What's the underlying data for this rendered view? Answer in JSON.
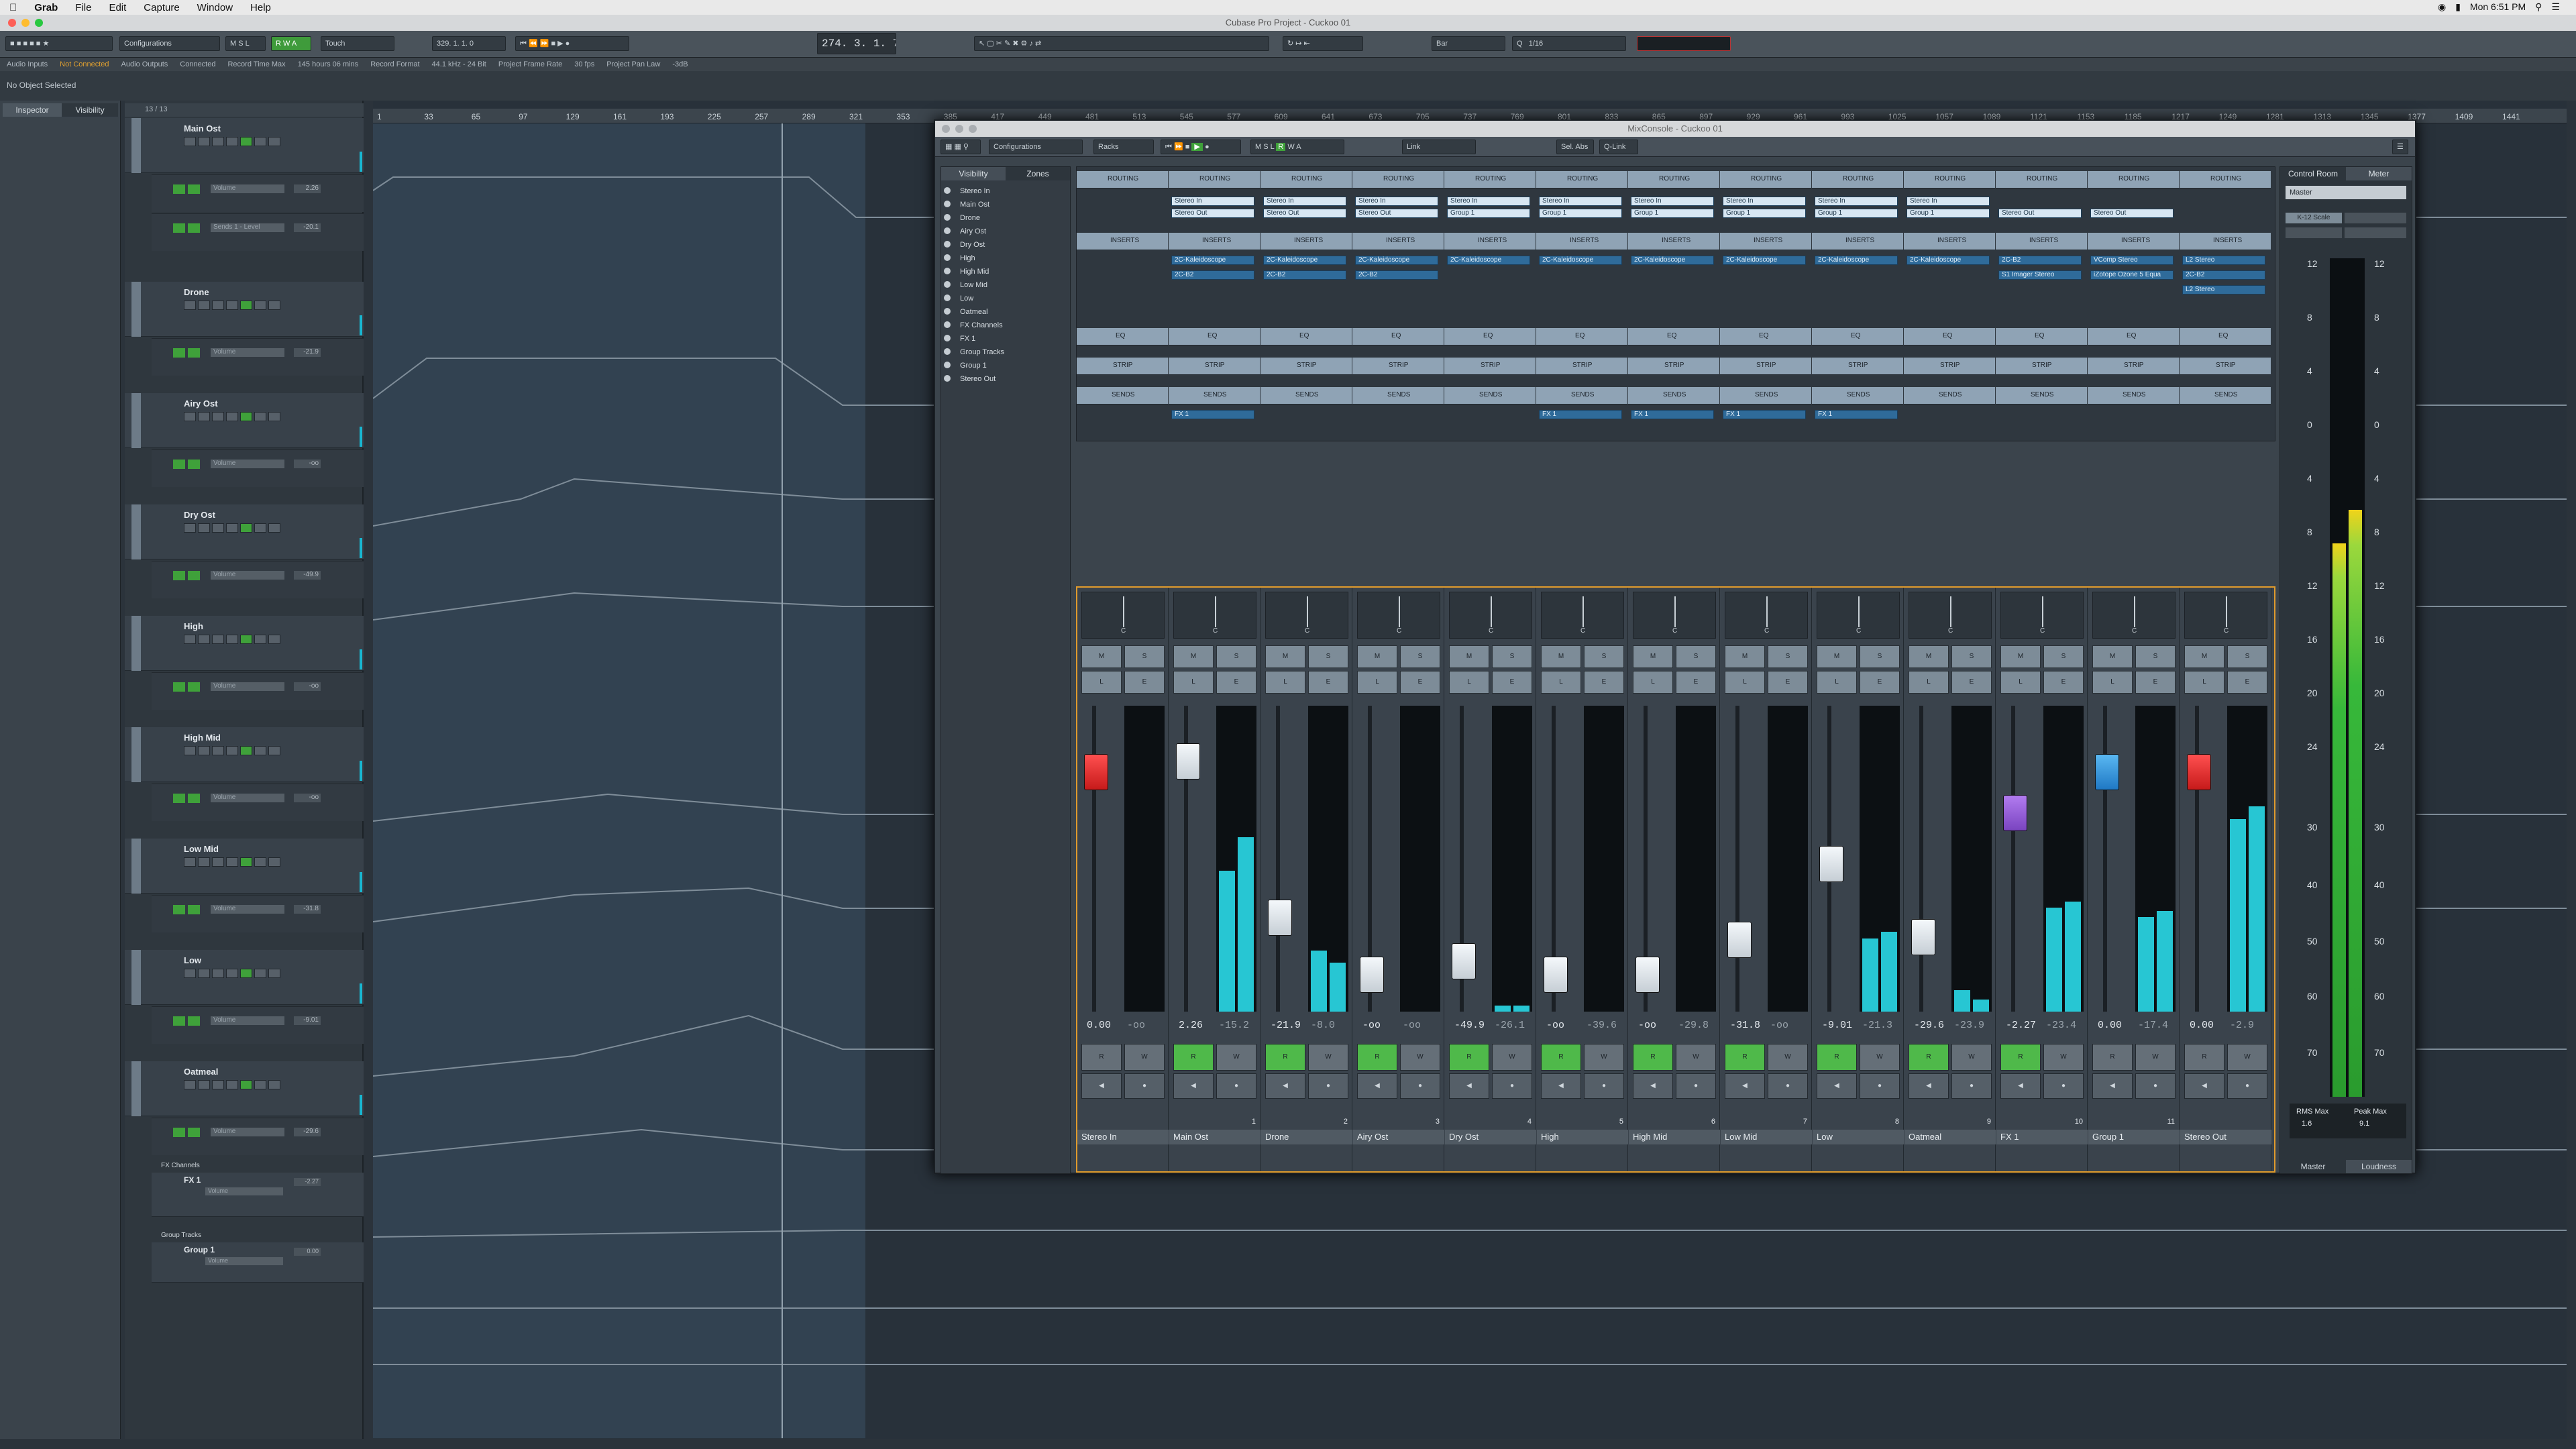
{
  "menubar": {
    "app": "Grab",
    "items": [
      "File",
      "Edit",
      "Capture",
      "Window",
      "Help"
    ],
    "time": "Mon 6:51 PM"
  },
  "window": {
    "title": "Cubase Pro Project - Cuckoo 01"
  },
  "toolbar": {
    "configurations": "Configurations",
    "touch": "Touch",
    "counter": "274. 3. 1. 79",
    "counter_small": "329. 1. 1. 0",
    "snap": "1/16",
    "bar": "Bar",
    "quantize": "Q"
  },
  "statusbar": {
    "audio_inputs": "Audio Inputs",
    "not_connected": "Not Connected",
    "audio_outputs": "Audio Outputs",
    "connected": "Connected",
    "record_time_label": "Record Time Max",
    "record_time": "145 hours 06 mins",
    "record_format_label": "Record Format",
    "record_format": "44.1 kHz - 24 Bit",
    "frame_rate_label": "Project Frame Rate",
    "frame_rate": "30 fps",
    "pan_law_label": "Project Pan Law",
    "pan_law": "-3dB"
  },
  "infoline": {
    "text": "No Object Selected"
  },
  "inspector": {
    "tabs": [
      "Inspector",
      "Visibility"
    ],
    "counter": "13 / 13"
  },
  "tracks": [
    {
      "name": "Main Ost",
      "lane": "Volume",
      "value": "2.26",
      "lane2": "Sends 1 - Level",
      "value2": "-20.1"
    },
    {
      "name": "Drone",
      "lane": "Volume",
      "value": "-21.9"
    },
    {
      "name": "Airy Ost",
      "lane": "Volume",
      "value": "-oo"
    },
    {
      "name": "Dry Ost",
      "lane": "Volume",
      "value": "-49.9"
    },
    {
      "name": "High",
      "lane": "Volume",
      "value": "-oo"
    },
    {
      "name": "High Mid",
      "lane": "Volume",
      "value": "-oo"
    },
    {
      "name": "Low Mid",
      "lane": "Volume",
      "value": "-31.8"
    },
    {
      "name": "Low",
      "lane": "Volume",
      "value": "-9.01"
    },
    {
      "name": "Oatmeal",
      "lane": "Volume",
      "value": "-29.6"
    }
  ],
  "folders": {
    "fx": "FX Channels",
    "fx1": "FX 1",
    "fx1_value": "-2.27",
    "group": "Group Tracks",
    "group1": "Group 1",
    "group1_value": "0.00",
    "lane": "Volume"
  },
  "ruler": [
    "1",
    "33",
    "65",
    "97",
    "129",
    "161",
    "193",
    "225",
    "257",
    "289",
    "321",
    "353",
    "385",
    "417",
    "449",
    "481",
    "513",
    "545",
    "577",
    "609",
    "641",
    "673",
    "705",
    "737",
    "769",
    "801",
    "833",
    "865",
    "897",
    "929",
    "961",
    "993",
    "1025",
    "1057",
    "1089",
    "1121",
    "1153",
    "1185",
    "1217",
    "1249",
    "1281",
    "1313",
    "1345",
    "1377",
    "1409",
    "1441"
  ],
  "mixer": {
    "title": "MixConsole - Cuckoo 01",
    "tool": {
      "configurations": "Configurations",
      "racks": "Racks",
      "link": "Link",
      "sel_abs": "Sel. Abs",
      "q_link": "Q-Link"
    },
    "visibility_tabs": [
      "Visibility",
      "Zones"
    ],
    "visibility_items": [
      "Stereo In",
      "Main Ost",
      "Drone",
      "Airy Ost",
      "Dry Ost",
      "High",
      "High Mid",
      "Low Mid",
      "Low",
      "Oatmeal",
      "FX Channels",
      "FX 1",
      "Group Tracks",
      "Group 1",
      "Stereo Out"
    ],
    "rack_labels": {
      "routing": "ROUTING",
      "inserts": "INSERTS",
      "eq": "EQ",
      "strip": "STRIP",
      "sends": "SENDS"
    },
    "channels": [
      {
        "name": "Stereo In",
        "num": "",
        "val": "0.00",
        "peak": "-oo",
        "in": "",
        "out": "",
        "ins": [],
        "send": "",
        "color": "r",
        "fader": 0.18,
        "m1": 0,
        "m2": 0,
        "rw": false
      },
      {
        "name": "Main Ost",
        "num": "1",
        "val": "2.26",
        "peak": "-15.2",
        "in": "Stereo In",
        "out": "Stereo Out",
        "ins": [
          "2C-Kaleidoscope",
          "2C-B2"
        ],
        "send": "FX 1",
        "color": "w",
        "fader": 0.14,
        "m1": 0.46,
        "m2": 0.57,
        "rw": true
      },
      {
        "name": "Drone",
        "num": "2",
        "val": "-21.9",
        "peak": "-8.0",
        "in": "Stereo In",
        "out": "Stereo Out",
        "ins": [
          "2C-Kaleidoscope",
          "2C-B2"
        ],
        "send": "",
        "color": "w",
        "fader": 0.72,
        "m1": 0.2,
        "m2": 0.16,
        "rw": true
      },
      {
        "name": "Airy Ost",
        "num": "3",
        "val": "-oo",
        "peak": "-oo",
        "in": "Stereo In",
        "out": "Stereo Out",
        "ins": [
          "2C-Kaleidoscope",
          "2C-B2"
        ],
        "send": "",
        "color": "w",
        "fader": 0.93,
        "m1": 0,
        "m2": 0,
        "rw": true
      },
      {
        "name": "Dry Ost",
        "num": "4",
        "val": "-49.9",
        "peak": "-26.1",
        "in": "Stereo In",
        "out": "Group 1",
        "ins": [
          "2C-Kaleidoscope"
        ],
        "send": "",
        "color": "w",
        "fader": 0.88,
        "m1": 0.02,
        "m2": 0.02,
        "rw": true
      },
      {
        "name": "High",
        "num": "5",
        "val": "-oo",
        "peak": "-39.6",
        "in": "Stereo In",
        "out": "Group 1",
        "ins": [
          "2C-Kaleidoscope"
        ],
        "send": "FX 1",
        "color": "w",
        "fader": 0.93,
        "m1": 0,
        "m2": 0,
        "rw": true
      },
      {
        "name": "High Mid",
        "num": "6",
        "val": "-oo",
        "peak": "-29.8",
        "in": "Stereo In",
        "out": "Group 1",
        "ins": [
          "2C-Kaleidoscope"
        ],
        "send": "FX 1",
        "color": "w",
        "fader": 0.93,
        "m1": 0,
        "m2": 0,
        "rw": true
      },
      {
        "name": "Low Mid",
        "num": "7",
        "val": "-31.8",
        "peak": "-oo",
        "in": "Stereo In",
        "out": "Group 1",
        "ins": [
          "2C-Kaleidoscope"
        ],
        "send": "FX 1",
        "color": "w",
        "fader": 0.8,
        "m1": 0,
        "m2": 0,
        "rw": true
      },
      {
        "name": "Low",
        "num": "8",
        "val": "-9.01",
        "peak": "-21.3",
        "in": "Stereo In",
        "out": "Group 1",
        "ins": [
          "2C-Kaleidoscope"
        ],
        "send": "FX 1",
        "color": "w",
        "fader": 0.52,
        "m1": 0.24,
        "m2": 0.26,
        "rw": true
      },
      {
        "name": "Oatmeal",
        "num": "9",
        "val": "-29.6",
        "peak": "-23.9",
        "in": "Stereo In",
        "out": "Group 1",
        "ins": [
          "2C-Kaleidoscope"
        ],
        "send": "",
        "color": "w",
        "fader": 0.79,
        "m1": 0.07,
        "m2": 0.04,
        "rw": true
      },
      {
        "name": "FX 1",
        "num": "10",
        "val": "-2.27",
        "peak": "-23.4",
        "in": "",
        "out": "Stereo Out",
        "ins": [
          "2C-B2",
          "S1 Imager Stereo"
        ],
        "send": "",
        "color": "p",
        "fader": 0.33,
        "m1": 0.34,
        "m2": 0.36,
        "rw": true
      },
      {
        "name": "Group 1",
        "num": "11",
        "val": "0.00",
        "peak": "-17.4",
        "in": "",
        "out": "Stereo Out",
        "ins": [
          "VComp Stereo",
          "iZotope Ozone 5 Equa"
        ],
        "send": "",
        "color": "b",
        "fader": 0.18,
        "m1": 0.31,
        "m2": 0.33,
        "rw": false
      },
      {
        "name": "Stereo Out",
        "num": "",
        "val": "0.00",
        "peak": "-2.9",
        "in": "",
        "out": "",
        "ins": [
          "L2 Stereo",
          "2C-B2",
          "L2 Stereo"
        ],
        "send": "",
        "color": "r",
        "fader": 0.18,
        "m1": 0.63,
        "m2": 0.67,
        "rw": false
      }
    ],
    "control_tabs": [
      "Control Room",
      "Meter"
    ],
    "control": {
      "master": "Master",
      "scale_label": "K-12 Scale",
      "scale_values": [
        "12",
        "8",
        "4",
        "0",
        "4",
        "8",
        "12",
        "16",
        "20",
        "24",
        "30",
        "40",
        "50",
        "60",
        "70"
      ],
      "rms_label": "RMS Max",
      "rms": "1.6",
      "peak_label": "Peak Max",
      "peak": "9.1",
      "bottom_tabs": [
        "Master",
        "Loudness"
      ],
      "level_l": 0.66,
      "level_r": 0.7
    }
  },
  "colors": {
    "accent": "#e09b2d",
    "meter": "#27c6d3",
    "green": "#3fa13a"
  }
}
